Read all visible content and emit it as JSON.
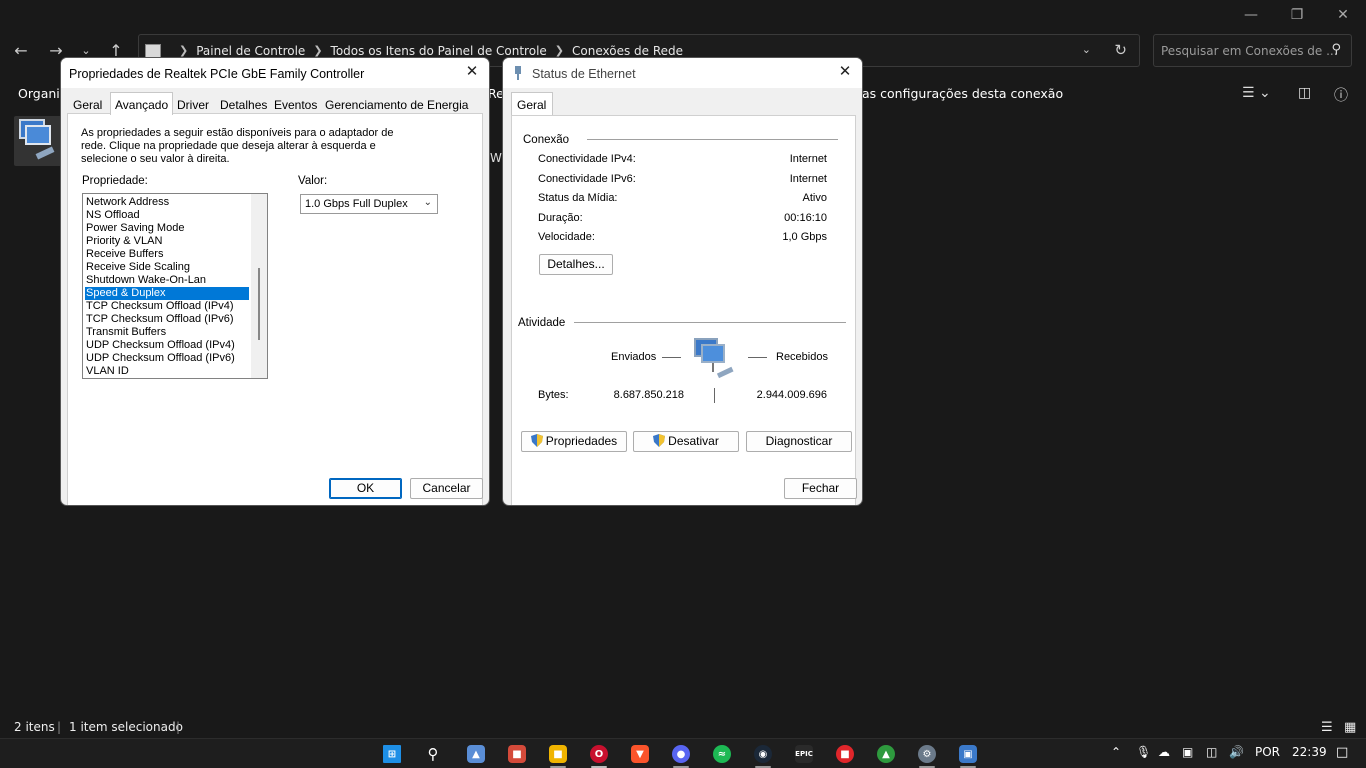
{
  "explorer": {
    "breadcrumb": [
      "Painel de Controle",
      "Todos os Itens do Painel de Controle",
      "Conexões de Rede"
    ],
    "search_placeholder": "Pesquisar em Conexões de ...",
    "cmd_organize": "Organiz",
    "cmd_partial_re": "Re",
    "cmd_partial_wi": "Wi",
    "cmd_change_settings": "as configurações desta conexão",
    "status_items": "2 itens",
    "status_selected": "1 item selecionado",
    "separator": "|"
  },
  "props_dialog": {
    "title": "Propriedades de Realtek PCIe GbE Family Controller",
    "tabs": [
      "Geral",
      "Avançado",
      "Driver",
      "Detalhes",
      "Eventos",
      "Gerenciamento de Energia"
    ],
    "description": "As propriedades a seguir estão disponíveis para o adaptador de rede. Clique na propriedade que deseja alterar à esquerda e selecione o seu valor à direita.",
    "property_label": "Propriedade:",
    "value_label": "Valor:",
    "properties": [
      "Network Address",
      "NS Offload",
      "Power Saving Mode",
      "Priority & VLAN",
      "Receive Buffers",
      "Receive Side Scaling",
      "Shutdown Wake-On-Lan",
      "Speed & Duplex",
      "TCP Checksum Offload (IPv4)",
      "TCP Checksum Offload (IPv6)",
      "Transmit Buffers",
      "UDP Checksum Offload (IPv4)",
      "UDP Checksum Offload (IPv6)",
      "VLAN ID"
    ],
    "selected_property": "Speed & Duplex",
    "value": "1.0 Gbps Full Duplex",
    "ok": "OK",
    "cancel": "Cancelar"
  },
  "status_dialog": {
    "title": "Status de Ethernet",
    "tab": "Geral",
    "connection_group": "Conexão",
    "rows": [
      {
        "label": "Conectividade IPv4:",
        "value": "Internet"
      },
      {
        "label": "Conectividade IPv6:",
        "value": "Internet"
      },
      {
        "label": "Status da Mídia:",
        "value": "Ativo"
      },
      {
        "label": "Duração:",
        "value": "00:16:10"
      },
      {
        "label": "Velocidade:",
        "value": "1,0 Gbps"
      }
    ],
    "details_button": "Detalhes...",
    "activity_group": "Atividade",
    "sent_label": "Enviados",
    "received_label": "Recebidos",
    "bytes_label": "Bytes:",
    "bytes_sent": "8.687.850.218",
    "bytes_received": "2.944.009.696",
    "properties_button": "Propriedades",
    "disable_button": "Desativar",
    "diagnose_button": "Diagnosticar",
    "close_button": "Fechar"
  },
  "taskbar": {
    "epic_label": "EPIC",
    "language": "POR",
    "time": "22:39"
  },
  "colors": {
    "selection": "#0078d7",
    "background": "#191919"
  }
}
